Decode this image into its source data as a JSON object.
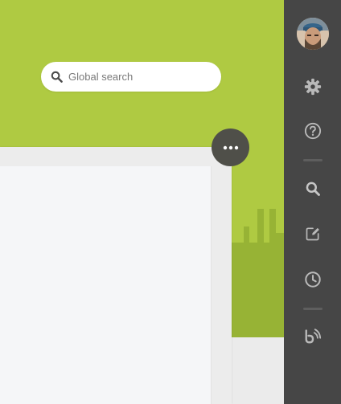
{
  "search": {
    "placeholder": "Global search"
  },
  "colors": {
    "hero_green": "#afca42",
    "skyline_back": "#a4bf3a",
    "skyline_front": "#97b335",
    "sidebar_bg": "#464646",
    "sidebar_icon": "#b9b9b9",
    "more_button_bg": "#4f4f49"
  },
  "sidebar": {
    "items": [
      {
        "icon": "avatar"
      },
      {
        "icon": "gear-icon"
      },
      {
        "icon": "help-icon"
      },
      {
        "icon": "search-icon"
      },
      {
        "icon": "compose-icon"
      },
      {
        "icon": "clock-icon"
      },
      {
        "icon": "feed-icon"
      }
    ]
  },
  "panel": {
    "more_icon": "ellipsis-icon"
  }
}
